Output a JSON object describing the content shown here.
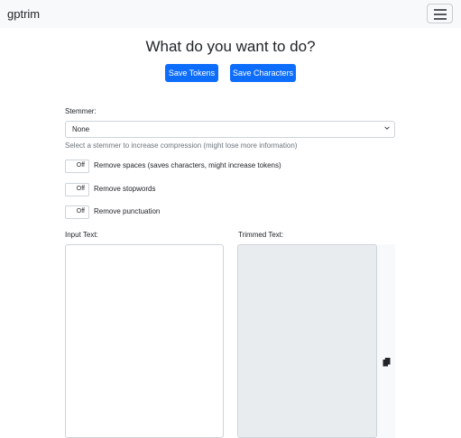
{
  "navbar": {
    "brand": "gptrim",
    "menu_icon": "hamburger-icon"
  },
  "main": {
    "title": "What do you want to do?",
    "save_tokens_label": "Save Tokens",
    "save_characters_label": "Save Characters"
  },
  "stemmer": {
    "label": "Stemmer:",
    "selected": "None",
    "help": "Select a stemmer to increase compression (might lose more information)"
  },
  "options": [
    {
      "state": "Off",
      "label": "Remove spaces (saves characters, might increase tokens)"
    },
    {
      "state": "Off",
      "label": "Remove stopwords"
    },
    {
      "state": "Off",
      "label": "Remove punctuation"
    }
  ],
  "input": {
    "label": "Input Text:",
    "value": ""
  },
  "output": {
    "label": "Trimmed Text:",
    "value": "",
    "copy_icon": "copy-icon"
  },
  "colors": {
    "primary": "#0d6efd",
    "navbar": "#f8f9fa",
    "readonly": "#e9ecef"
  }
}
